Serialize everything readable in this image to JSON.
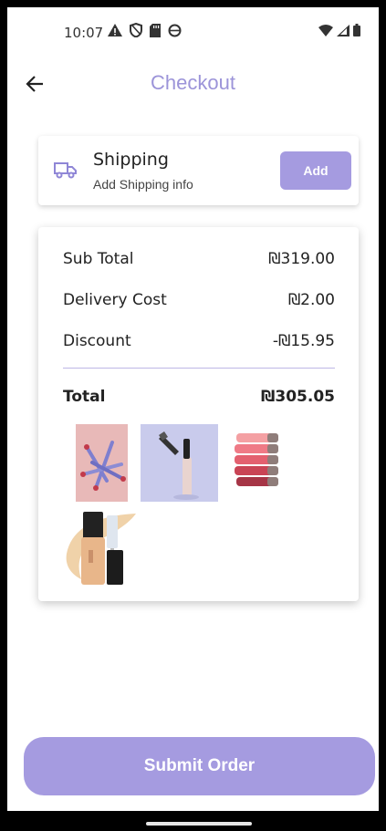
{
  "status_bar": {
    "time": "10:07",
    "left_icons": [
      "alert-triangle-icon",
      "shield-icon",
      "sd-card-icon",
      "circle-icon"
    ],
    "right_icons": [
      "wifi-icon",
      "signal-icon",
      "battery-icon"
    ]
  },
  "header": {
    "title": "Checkout",
    "back_icon": "arrow-left-icon"
  },
  "shipping": {
    "icon": "truck-icon",
    "title": "Shipping",
    "subtitle": "Add Shipping info",
    "add_label": "Add"
  },
  "summary": {
    "rows": [
      {
        "label": "Sub Total",
        "value": "₪319.00"
      },
      {
        "label": "Delivery Cost",
        "value": "₪2.00"
      },
      {
        "label": "Discount",
        "value": "-₪15.95"
      }
    ],
    "total": {
      "label": "Total",
      "value": "₪305.05"
    },
    "products": [
      {
        "name": "lip-liner-pencils-image"
      },
      {
        "name": "mascara-image"
      },
      {
        "name": "lipstick-stack-image"
      },
      {
        "name": "foundation-concealer-image"
      }
    ]
  },
  "footer": {
    "submit_label": "Submit Order"
  },
  "colors": {
    "accent": "#a59be0",
    "title": "#9c94d9",
    "divider": "#bdb6e6"
  }
}
